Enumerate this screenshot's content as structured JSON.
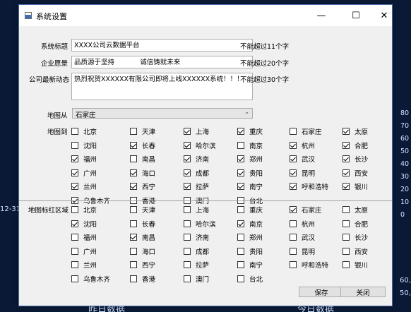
{
  "window": {
    "title": "系统设置",
    "min_glyph": "—",
    "max_glyph": "☐",
    "close_glyph": "✕"
  },
  "form": {
    "system_title": {
      "label": "系统标题",
      "value": "XXXX公司云数据平台",
      "hint": "不能超过11个字"
    },
    "slogan": {
      "label": "企业愿景",
      "value": "品质源于坚持            诚信铸就未来",
      "hint": "不能超过20个字"
    },
    "news": {
      "label": "公司最新动态",
      "value": "热烈祝贺XXXXXX有限公司即将上线XXXXXX系统！！！",
      "hint": "不能超过30个字"
    },
    "map_from": {
      "label": "地图从",
      "value": "石家庄"
    }
  },
  "map_to": {
    "label": "地图到",
    "rows": [
      [
        [
          "北京",
          false
        ],
        [
          "天津",
          false
        ],
        [
          "上海",
          true
        ],
        [
          "重庆",
          true
        ],
        [
          "石家庄",
          false
        ],
        [
          "太原",
          true
        ]
      ],
      [
        [
          "沈阳",
          false
        ],
        [
          "长春",
          true
        ],
        [
          "哈尔滨",
          true
        ],
        [
          "南京",
          false
        ],
        [
          "杭州",
          true
        ],
        [
          "合肥",
          true
        ]
      ],
      [
        [
          "福州",
          true
        ],
        [
          "南昌",
          false
        ],
        [
          "济南",
          true
        ],
        [
          "郑州",
          true
        ],
        [
          "武汉",
          true
        ],
        [
          "长沙",
          true
        ]
      ],
      [
        [
          "广州",
          true
        ],
        [
          "海口",
          true
        ],
        [
          "成都",
          true
        ],
        [
          "贵阳",
          true
        ],
        [
          "昆明",
          true
        ],
        [
          "西安",
          true
        ]
      ],
      [
        [
          "兰州",
          true
        ],
        [
          "西宁",
          true
        ],
        [
          "拉萨",
          true
        ],
        [
          "南宁",
          true
        ],
        [
          "呼和浩特",
          true
        ],
        [
          "银川",
          true
        ]
      ],
      [
        [
          "乌鲁木齐",
          true
        ],
        [
          "香港",
          false
        ],
        [
          "澳门",
          false
        ],
        [
          "台北",
          false
        ]
      ]
    ]
  },
  "red_region": {
    "label": "地图标红区域",
    "rows": [
      [
        [
          "北京",
          false
        ],
        [
          "天津",
          false
        ],
        [
          "上海",
          false
        ],
        [
          "重庆",
          false
        ],
        [
          "石家庄",
          true
        ],
        [
          "太原",
          false
        ]
      ],
      [
        [
          "沈阳",
          true
        ],
        [
          "长春",
          false
        ],
        [
          "哈尔滨",
          false
        ],
        [
          "南京",
          true
        ],
        [
          "杭州",
          false
        ],
        [
          "合肥",
          false
        ]
      ],
      [
        [
          "福州",
          false
        ],
        [
          "南昌",
          true
        ],
        [
          "济南",
          false
        ],
        [
          "郑州",
          false
        ],
        [
          "武汉",
          false
        ],
        [
          "长沙",
          false
        ]
      ],
      [
        [
          "广州",
          false
        ],
        [
          "海口",
          false
        ],
        [
          "成都",
          false
        ],
        [
          "贵阳",
          false
        ],
        [
          "昆明",
          false
        ],
        [
          "西安",
          false
        ]
      ],
      [
        [
          "兰州",
          false
        ],
        [
          "西宁",
          false
        ],
        [
          "拉萨",
          false
        ],
        [
          "南宁",
          false
        ],
        [
          "呼和浩特",
          false
        ],
        [
          "银川",
          false
        ]
      ],
      [
        [
          "乌鲁木齐",
          false
        ],
        [
          "香港",
          false
        ],
        [
          "澳门",
          false
        ],
        [
          "台北",
          false
        ]
      ]
    ]
  },
  "buttons": {
    "save": "保存",
    "close": "关闭"
  },
  "background": {
    "left_date": "12-31",
    "bottom_left": "昨日数据",
    "bottom_right": "今日数据",
    "axis": [
      "80",
      "70",
      "60",
      "50",
      "40",
      "30",
      "20",
      "10",
      "0"
    ],
    "corner_top": "60,",
    "corner_bottom": "50,"
  }
}
